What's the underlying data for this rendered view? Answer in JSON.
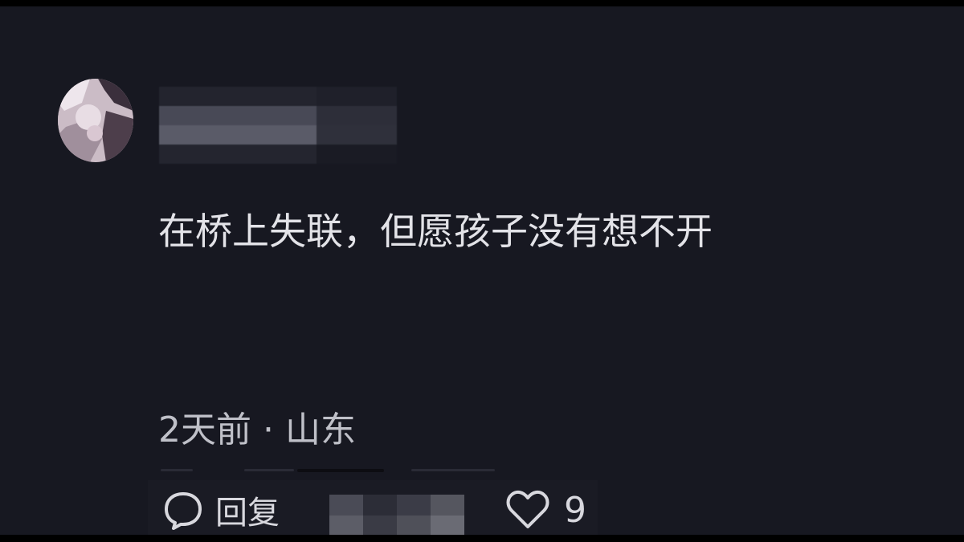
{
  "comment": {
    "text": "在桥上失联，但愿孩子没有想不开",
    "time": "2天前",
    "separator": "·",
    "location": "山东"
  },
  "actions": {
    "reply_label": "回复",
    "like_count": "9"
  },
  "icons": {
    "reply": "speech-bubble-icon",
    "like": "heart-outline-icon"
  },
  "colors": {
    "background": "#171821",
    "text_primary": "#e3e3e8",
    "text_secondary": "#bfc0c8"
  }
}
